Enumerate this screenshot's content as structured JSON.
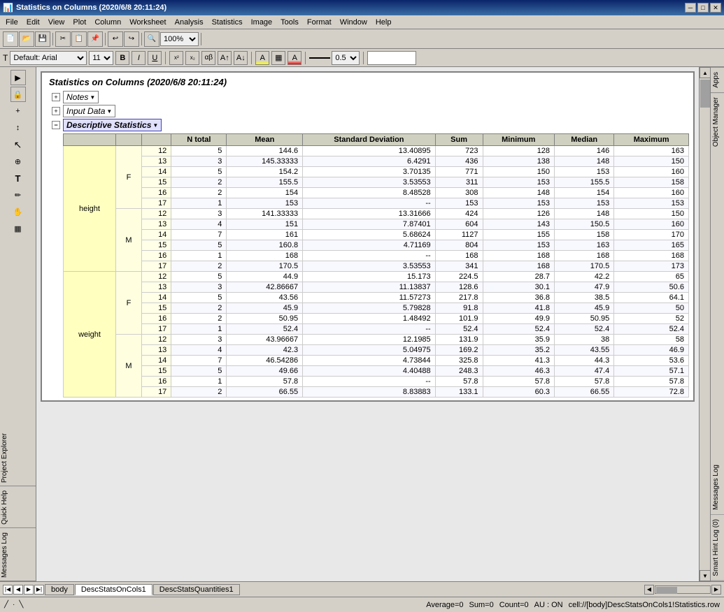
{
  "app": {
    "title": "Statistics on Columns (2020/6/8 20:11:24)"
  },
  "menubar": {
    "items": [
      "File",
      "Edit",
      "View",
      "Plot",
      "Column",
      "Worksheet",
      "Analysis",
      "Statistics",
      "Image",
      "Tools",
      "Format",
      "Window",
      "Help"
    ]
  },
  "format_bar": {
    "font_name": "Default: Arial",
    "font_size": "11",
    "bold": "B",
    "italic": "I",
    "underline": "U"
  },
  "tree": {
    "notes_label": "Notes",
    "input_data_label": "Input Data",
    "desc_stats_label": "Descriptive Statistics"
  },
  "table": {
    "headers": [
      "N total",
      "Mean",
      "Standard Deviation",
      "Sum",
      "Minimum",
      "Median",
      "Maximum"
    ],
    "col_labels": [
      "height",
      "weight"
    ],
    "gender_f": "F",
    "gender_m": "M",
    "rows": [
      {
        "group": "height",
        "gender": "F",
        "age": "12",
        "n": "5",
        "mean": "144.6",
        "sd": "13.40895",
        "sum": "723",
        "min": "128",
        "median": "146",
        "max": "163"
      },
      {
        "group": "height",
        "gender": "F",
        "age": "13",
        "n": "3",
        "mean": "145.33333",
        "sd": "6.4291",
        "sum": "436",
        "min": "138",
        "median": "148",
        "max": "150"
      },
      {
        "group": "height",
        "gender": "F",
        "age": "14",
        "n": "5",
        "mean": "154.2",
        "sd": "3.70135",
        "sum": "771",
        "min": "150",
        "median": "153",
        "max": "160"
      },
      {
        "group": "height",
        "gender": "F",
        "age": "15",
        "n": "2",
        "mean": "155.5",
        "sd": "3.53553",
        "sum": "311",
        "min": "153",
        "median": "155.5",
        "max": "158"
      },
      {
        "group": "height",
        "gender": "F",
        "age": "16",
        "n": "2",
        "mean": "154",
        "sd": "8.48528",
        "sum": "308",
        "min": "148",
        "median": "154",
        "max": "160"
      },
      {
        "group": "height",
        "gender": "F",
        "age": "17",
        "n": "1",
        "mean": "153",
        "sd": "--",
        "sum": "153",
        "min": "153",
        "median": "153",
        "max": "153"
      },
      {
        "group": "height",
        "gender": "M",
        "age": "12",
        "n": "3",
        "mean": "141.33333",
        "sd": "13.31666",
        "sum": "424",
        "min": "126",
        "median": "148",
        "max": "150"
      },
      {
        "group": "height",
        "gender": "M",
        "age": "13",
        "n": "4",
        "mean": "151",
        "sd": "7.87401",
        "sum": "604",
        "min": "143",
        "median": "150.5",
        "max": "160"
      },
      {
        "group": "height",
        "gender": "M",
        "age": "14",
        "n": "7",
        "mean": "161",
        "sd": "5.68624",
        "sum": "1127",
        "min": "155",
        "median": "158",
        "max": "170"
      },
      {
        "group": "height",
        "gender": "M",
        "age": "15",
        "n": "5",
        "mean": "160.8",
        "sd": "4.71169",
        "sum": "804",
        "min": "153",
        "median": "163",
        "max": "165"
      },
      {
        "group": "height",
        "gender": "M",
        "age": "16",
        "n": "1",
        "mean": "168",
        "sd": "--",
        "sum": "168",
        "min": "168",
        "median": "168",
        "max": "168"
      },
      {
        "group": "height",
        "gender": "M",
        "age": "17",
        "n": "2",
        "mean": "170.5",
        "sd": "3.53553",
        "sum": "341",
        "min": "168",
        "median": "170.5",
        "max": "173"
      },
      {
        "group": "weight",
        "gender": "F",
        "age": "12",
        "n": "5",
        "mean": "44.9",
        "sd": "15.173",
        "sum": "224.5",
        "min": "28.7",
        "median": "42.2",
        "max": "65"
      },
      {
        "group": "weight",
        "gender": "F",
        "age": "13",
        "n": "3",
        "mean": "42.86667",
        "sd": "11.13837",
        "sum": "128.6",
        "min": "30.1",
        "median": "47.9",
        "max": "50.6"
      },
      {
        "group": "weight",
        "gender": "F",
        "age": "14",
        "n": "5",
        "mean": "43.56",
        "sd": "11.57273",
        "sum": "217.8",
        "min": "36.8",
        "median": "38.5",
        "max": "64.1"
      },
      {
        "group": "weight",
        "gender": "F",
        "age": "15",
        "n": "2",
        "mean": "45.9",
        "sd": "5.79828",
        "sum": "91.8",
        "min": "41.8",
        "median": "45.9",
        "max": "50"
      },
      {
        "group": "weight",
        "gender": "F",
        "age": "16",
        "n": "2",
        "mean": "50.95",
        "sd": "1.48492",
        "sum": "101.9",
        "min": "49.9",
        "median": "50.95",
        "max": "52"
      },
      {
        "group": "weight",
        "gender": "F",
        "age": "17",
        "n": "1",
        "mean": "52.4",
        "sd": "--",
        "sum": "52.4",
        "min": "52.4",
        "median": "52.4",
        "max": "52.4"
      },
      {
        "group": "weight",
        "gender": "M",
        "age": "12",
        "n": "3",
        "mean": "43.96667",
        "sd": "12.1985",
        "sum": "131.9",
        "min": "35.9",
        "median": "38",
        "max": "58"
      },
      {
        "group": "weight",
        "gender": "M",
        "age": "13",
        "n": "4",
        "mean": "42.3",
        "sd": "5.04975",
        "sum": "169.2",
        "min": "35.2",
        "median": "43.55",
        "max": "46.9"
      },
      {
        "group": "weight",
        "gender": "M",
        "age": "14",
        "n": "7",
        "mean": "46.54286",
        "sd": "4.73844",
        "sum": "325.8",
        "min": "41.3",
        "median": "44.3",
        "max": "53.6"
      },
      {
        "group": "weight",
        "gender": "M",
        "age": "15",
        "n": "5",
        "mean": "49.66",
        "sd": "4.40488",
        "sum": "248.3",
        "min": "46.3",
        "median": "47.4",
        "max": "57.1"
      },
      {
        "group": "weight",
        "gender": "M",
        "age": "16",
        "n": "1",
        "mean": "57.8",
        "sd": "--",
        "sum": "57.8",
        "min": "57.8",
        "median": "57.8",
        "max": "57.8"
      },
      {
        "group": "weight",
        "gender": "M",
        "age": "17",
        "n": "2",
        "mean": "66.55",
        "sd": "8.83883",
        "sum": "133.1",
        "min": "60.3",
        "median": "66.55",
        "max": "72.8"
      }
    ]
  },
  "sheet_tabs": {
    "tabs": [
      "body",
      "DescStatsOnCols1",
      "DescStatsQuantities1"
    ]
  },
  "status_bar": {
    "average": "Average=0",
    "sum": "Sum=0",
    "count": "Count=0",
    "au": "AU : ON",
    "cell": "cell://[body]DescStatsOnCols1!Statistics.row"
  },
  "right_panels": {
    "apps": "Apps",
    "object_manager": "Object Manager",
    "messages_log": "Messages Log",
    "smart_hint": "Smart Hint Log (0)"
  }
}
